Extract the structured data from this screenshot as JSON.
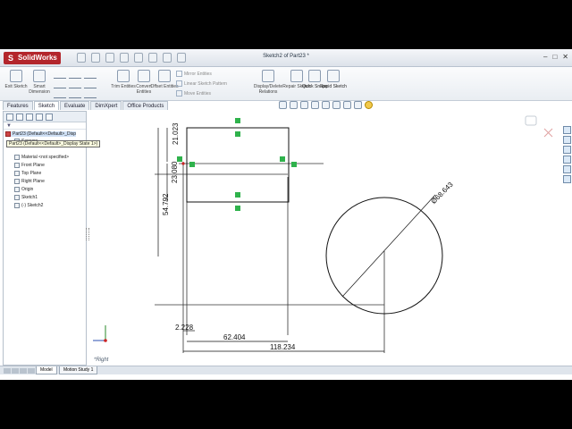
{
  "app": {
    "logo": "SolidWorks",
    "document_title": "Sketch2 of Part23 *"
  },
  "ribbon": {
    "exit_sketch": "Exit Sketch",
    "smart_dimension": "Smart Dimension",
    "trim_entities": "Trim Entities",
    "convert_entities": "Convert Entities",
    "offset_entities": "Offset Entities",
    "mirror_entities": "Mirror Entities",
    "linear_sketch_pattern": "Linear Sketch Pattern",
    "move_entities": "Move Entities",
    "display_delete_relations": "Display/Delete Relations",
    "repair_sketch": "Repair Sketch",
    "quick_snaps": "Quick Snaps",
    "rapid_sketch": "Rapid Sketch"
  },
  "tabs": [
    "Features",
    "Sketch",
    "Evaluate",
    "DimXpert",
    "Office Products"
  ],
  "active_tab": "Sketch",
  "tree": {
    "root": "Part23 (Default<<Default>_Disp",
    "tooltip": "Part23 (Default<<Default>_Display State 1>)",
    "items": [
      "Sensors",
      "Annotations",
      "Material <not specified>",
      "Front Plane",
      "Top Plane",
      "Right Plane",
      "Origin",
      "Sketch1",
      "(-) Sketch2"
    ]
  },
  "dimensions": {
    "top_height": "21.023",
    "lower_height": "23.080",
    "total_height": "54.792",
    "circle_diameter": "Ø68.643",
    "left_offset": "2.228",
    "rect_width": "62.404",
    "total_width": "118.234"
  },
  "view_label": "*Right",
  "bottom_tabs": [
    "Model",
    "Motion Study 1"
  ],
  "colors": {
    "relation_marker": "#2fb24c",
    "origin_red": "#cc2222",
    "sketch_line": "#111111",
    "construction": "#333333"
  }
}
